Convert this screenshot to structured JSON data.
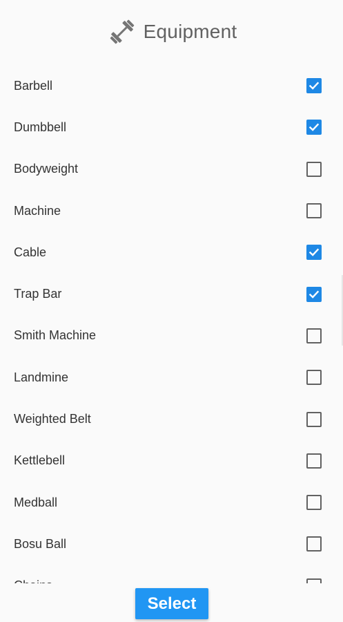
{
  "header": {
    "title": "Equipment",
    "icon": "dumbbell-icon"
  },
  "items": [
    {
      "label": "Barbell",
      "checked": true
    },
    {
      "label": "Dumbbell",
      "checked": true
    },
    {
      "label": "Bodyweight",
      "checked": false
    },
    {
      "label": "Machine",
      "checked": false
    },
    {
      "label": "Cable",
      "checked": true
    },
    {
      "label": "Trap Bar",
      "checked": true
    },
    {
      "label": "Smith Machine",
      "checked": false
    },
    {
      "label": "Landmine",
      "checked": false
    },
    {
      "label": "Weighted Belt",
      "checked": false
    },
    {
      "label": "Kettlebell",
      "checked": false
    },
    {
      "label": "Medball",
      "checked": false
    },
    {
      "label": "Bosu Ball",
      "checked": false
    },
    {
      "label": "Chains",
      "checked": false
    }
  ],
  "footer": {
    "select_label": "Select"
  },
  "colors": {
    "accent": "#1e88e5",
    "button": "#2196f3"
  }
}
